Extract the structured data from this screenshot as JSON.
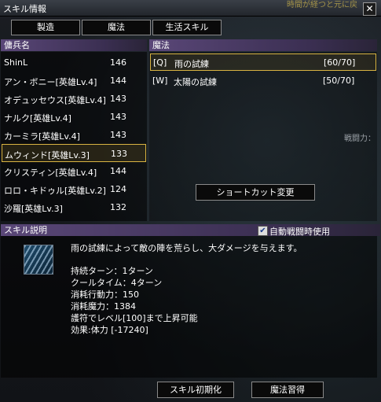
{
  "window": {
    "title": "スキル情報",
    "overlay_text": "時間が経つと元に戻"
  },
  "tabs": [
    {
      "label": "製造"
    },
    {
      "label": "魔法"
    },
    {
      "label": "生活スキル"
    }
  ],
  "mercenaries": {
    "header": "傭兵名",
    "items": [
      {
        "name": "ShinL",
        "level": "146"
      },
      {
        "name": "アン・ボニー[英雄Lv.4]",
        "level": "144"
      },
      {
        "name": "オデュッセウス[英雄Lv.4]",
        "level": "143"
      },
      {
        "name": "ナルク[英雄Lv.4]",
        "level": "143"
      },
      {
        "name": "カーミラ[英雄Lv.4]",
        "level": "143"
      },
      {
        "name": "ムウィンド[英雄Lv.3]",
        "level": "133",
        "selected": true
      },
      {
        "name": "クリスティン[英雄Lv.4]",
        "level": "144"
      },
      {
        "name": "ロロ・キドゥル[英雄Lv.2]",
        "level": "124"
      },
      {
        "name": "沙羅[英雄Lv.3]",
        "level": "132"
      }
    ]
  },
  "magic": {
    "header": "魔法",
    "items": [
      {
        "key": "[Q]",
        "name": "雨の試練",
        "count": "[60/70]",
        "selected": true
      },
      {
        "key": "[W]",
        "name": "太陽の試練",
        "count": "[50/70]"
      }
    ],
    "shortcut_button": "ショートカット変更",
    "side_label": "戦闘力："
  },
  "skill_desc": {
    "header": "スキル説明",
    "auto_battle_label": "自動戦闘時使用",
    "auto_battle_checked": true,
    "icon": "rain-skill-icon",
    "description": "雨の試練によって敵の陣を荒らし、大ダメージを与えます。",
    "stats": [
      "持続ターン：1ターン",
      "クールタイム：4ターン",
      "消耗行動力：150",
      "消耗魔力：1384",
      "護符でレベル[100]まで上昇可能",
      "効果:体力 [-17240]"
    ]
  },
  "buttons": {
    "reset": "スキル初期化",
    "learn": "魔法習得"
  },
  "colors": {
    "header_purple": "#5a4778",
    "selection_gold": "#d8b342"
  }
}
